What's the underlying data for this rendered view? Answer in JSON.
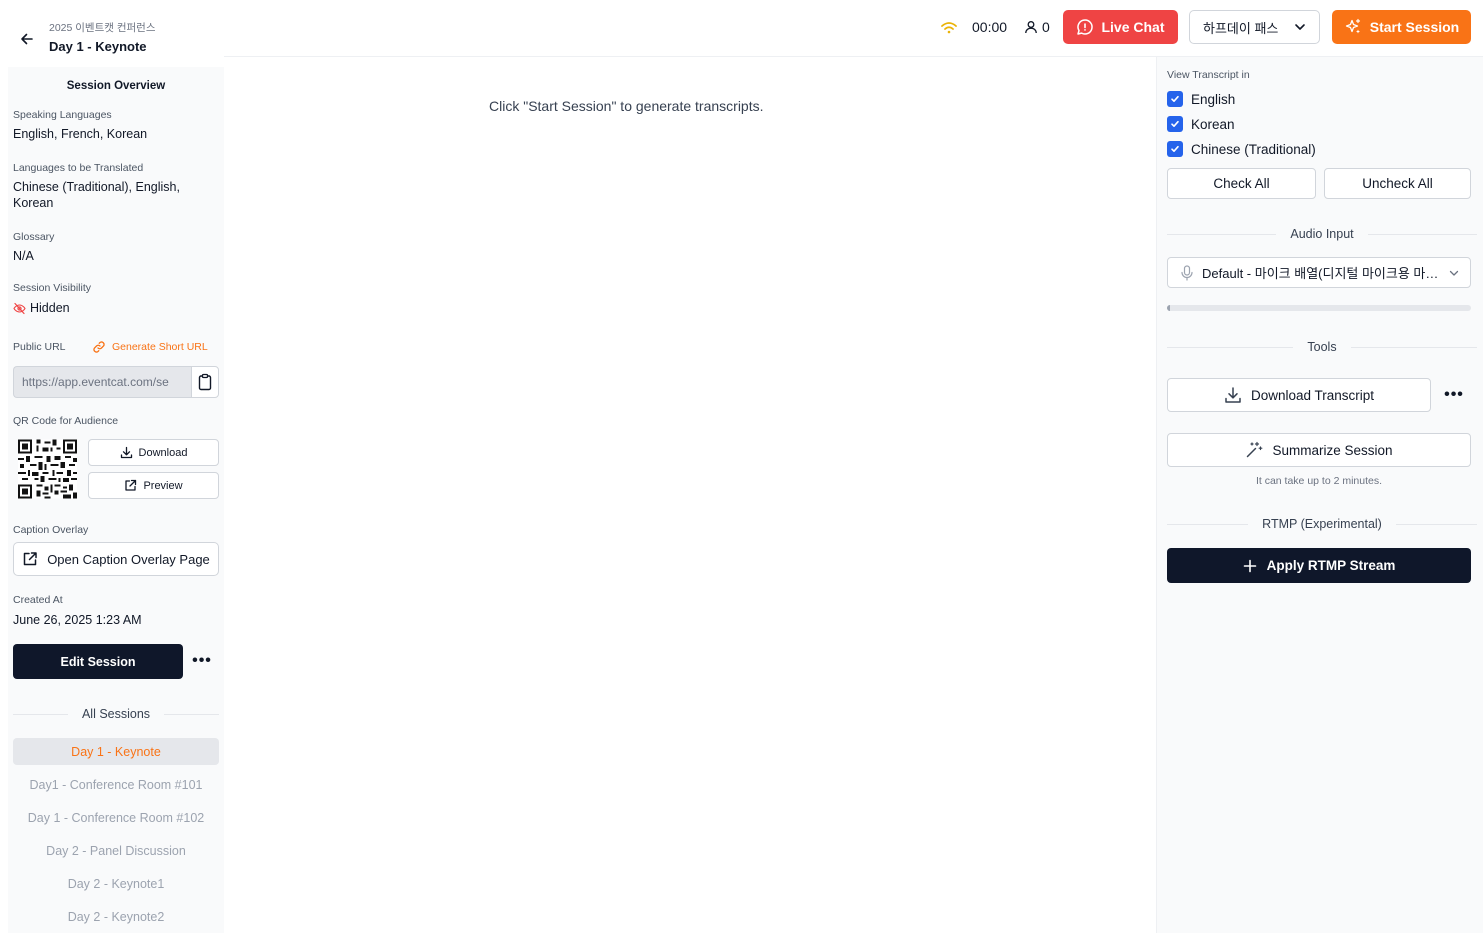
{
  "header": {
    "event_name": "2025 이벤트캣 컨퍼런스",
    "session_title": "Day 1 - Keynote",
    "timer": "00:00",
    "audience_count": "0",
    "live_chat_label": "Live Chat",
    "pass_select_value": "하프데이 패스",
    "start_session_label": "Start Session"
  },
  "sidebar": {
    "title": "Session Overview",
    "speaking_languages_label": "Speaking Languages",
    "speaking_languages_value": "English, French, Korean",
    "translated_languages_label": "Languages to be Translated",
    "translated_languages_value": "Chinese (Traditional), English, Korean",
    "glossary_label": "Glossary",
    "glossary_value": "N/A",
    "visibility_label": "Session Visibility",
    "visibility_value": "Hidden",
    "public_url_label": "Public URL",
    "generate_short_url_label": "Generate Short URL",
    "public_url_value": "https://app.eventcat.com/se",
    "qr_label": "QR Code for Audience",
    "qr_download_label": "Download",
    "qr_preview_label": "Preview",
    "caption_overlay_label": "Caption Overlay",
    "caption_overlay_button": "Open Caption Overlay Page",
    "created_at_label": "Created At",
    "created_at_value": "June 26, 2025 1:23 AM",
    "edit_session_label": "Edit Session",
    "more_label": "•••",
    "all_sessions_label": "All Sessions",
    "sessions": [
      {
        "label": "Day 1 - Keynote",
        "active": true
      },
      {
        "label": "Day1 - Conference Room #101",
        "active": false
      },
      {
        "label": "Day 1 - Conference Room #102",
        "active": false
      },
      {
        "label": "Day 2 - Panel Discussion",
        "active": false
      },
      {
        "label": "Day 2 - Keynote1",
        "active": false
      },
      {
        "label": "Day 2 - Keynote2",
        "active": false
      }
    ]
  },
  "main": {
    "hint": "Click \"Start Session\" to generate transcripts."
  },
  "right_panel": {
    "view_transcript_label": "View Transcript in",
    "languages": [
      {
        "label": "English",
        "checked": true
      },
      {
        "label": "Korean",
        "checked": true
      },
      {
        "label": "Chinese (Traditional)",
        "checked": true
      }
    ],
    "check_all_label": "Check All",
    "uncheck_all_label": "Uncheck All",
    "audio_input_label": "Audio Input",
    "audio_input_value": "Default - 마이크 배열(디지털 마이크용 마이크 어레이)",
    "audio_level_fraction": 0.01,
    "tools_label": "Tools",
    "download_transcript_label": "Download Transcript",
    "more_label": "•••",
    "summarize_label": "Summarize Session",
    "summarize_note": "It can take up to 2 minutes.",
    "rtmp_label": "RTMP (Experimental)",
    "apply_rtmp_label": "Apply RTMP Stream"
  },
  "colors": {
    "accent_orange": "#f97316",
    "live_red": "#ef4444",
    "dark_navy": "#0f172a",
    "checkbox_blue": "#2563eb"
  }
}
